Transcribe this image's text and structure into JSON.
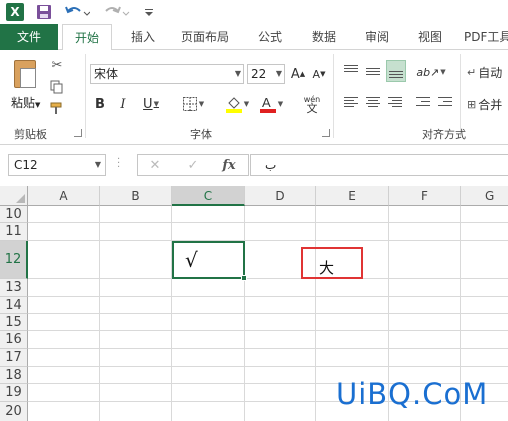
{
  "quick_access": {
    "app_icon": "X",
    "icons": [
      "excel-logo-icon",
      "save-icon",
      "undo-icon",
      "redo-icon",
      "customize-toolbar-icon"
    ]
  },
  "ribbon_tabs": [
    {
      "label": "文件"
    },
    {
      "label": "开始"
    },
    {
      "label": "插入"
    },
    {
      "label": "页面布局"
    },
    {
      "label": "公式"
    },
    {
      "label": "数据"
    },
    {
      "label": "审阅"
    },
    {
      "label": "视图"
    },
    {
      "label": "PDF工具"
    }
  ],
  "clipboard": {
    "paste_label": "粘贴",
    "group_label": "剪贴板"
  },
  "font": {
    "name": "宋体",
    "size": "22",
    "group_label": "字体",
    "bold": "B",
    "italic": "I",
    "underline": "U",
    "phonetic": "wén"
  },
  "alignment": {
    "group_label": "对齐方式",
    "wrap_label": "自动",
    "merge_label": "合并"
  },
  "formula_bar": {
    "name_box": "C12",
    "cancel": "✕",
    "enter": "✓",
    "fx": "fx",
    "content": "ب"
  },
  "grid": {
    "columns": [
      "A",
      "B",
      "C",
      "D",
      "E",
      "F",
      "G"
    ],
    "rows": [
      "10",
      "11",
      "12",
      "13",
      "14",
      "15",
      "16",
      "17",
      "18",
      "19",
      "20"
    ],
    "selected_cell": "C12",
    "cells": {
      "C12": "√",
      "E12": "大"
    }
  },
  "watermark": "UiBQ.CoM",
  "colors": {
    "excel_green": "#217346",
    "highlight_red": "#e03434",
    "watermark_blue": "#1a6fd1"
  }
}
